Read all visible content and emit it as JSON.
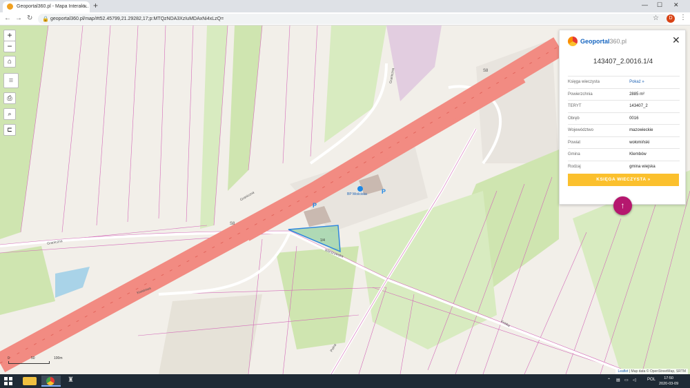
{
  "browser": {
    "tab_title": "Geoportal360.pl - Mapa Interakt...",
    "tab_close": "×",
    "new_tab": "+",
    "url": "geoportal360.pl/map/#t52.45799,21.29282,17;p:MTQzNDA3XzIuMDAxNi4xLzQ=",
    "profile_initial": "D",
    "window_minimize": "—",
    "window_maximize": "☐",
    "window_close": "✕"
  },
  "map_controls": {
    "zoom_in": "+",
    "zoom_out": "−"
  },
  "panel": {
    "brand_name": "Geoportal",
    "brand_suffix": "360.pl",
    "parcel_id": "143407_2.0016.1/4",
    "rows": [
      {
        "label": "Księga wieczysta",
        "value": "Pokaż »"
      },
      {
        "label": "Powierzchnia",
        "value": "2885 m²"
      },
      {
        "label": "TERYT",
        "value": "143407_2"
      },
      {
        "label": "Obręb",
        "value": "0016"
      },
      {
        "label": "Województwo",
        "value": "mazowieckie"
      },
      {
        "label": "Powiat",
        "value": "wołomiński"
      },
      {
        "label": "Gmina",
        "value": "Klembów"
      },
      {
        "label": "Rodzaj",
        "value": "gmina wiejska"
      }
    ],
    "kw_button": "KSIĘGA WIECZYSTA »"
  },
  "map_labels": {
    "road_s8_a": "S8",
    "road_s8_b": "S8",
    "station": "BP Mościska",
    "parking_a": "P",
    "parking_b": "P",
    "street_a": "Graniczna",
    "street_b": "Graniczna",
    "street_c": "Graniczna",
    "street_d": "Kwiatowa",
    "street_e": "Warszawska",
    "street_f": "Krótka",
    "street_g": "Polna",
    "parcel_label": "1/4",
    "scale_0": "0",
    "scale_50": "50",
    "scale_100": "100m"
  },
  "attribution": {
    "leaflet": "Leaflet",
    "text": "| Map data © OpenStreetMap, SRTM"
  },
  "taskbar": {
    "lang": "POL",
    "time": "17:50",
    "date": "2020-03-09"
  },
  "colors": {
    "expressway": "#f28b82",
    "parcel_line": "#d36ab8",
    "selected_parcel": "#2e86de",
    "accent": "#fbc02d",
    "fab": "#b5176e"
  }
}
